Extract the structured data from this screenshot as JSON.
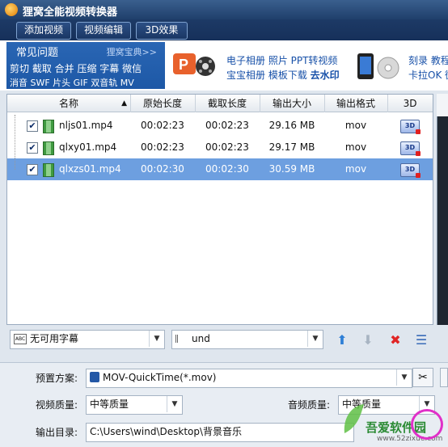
{
  "window": {
    "title": "狸窝全能视频转换器"
  },
  "toolbar": {
    "add_video": "添加视频",
    "edit_video": "视频编辑",
    "effect_3d": "3D效果"
  },
  "faq": {
    "title": "常见问题",
    "more": "狸窝宝典>>",
    "line1": "剪切 截取 合并 压缩 字幕 微信",
    "line2": "消音 SWF 片头 GIF 双音轨 MV"
  },
  "promo": {
    "line1": "电子相册  照片  PPT转视频",
    "line2a": "宝宝相册  模板下载",
    "line2b": "去水印",
    "line3": "刻录  教程",
    "line4": "卡拉OK  微"
  },
  "table": {
    "headers": [
      "名称",
      "原始长度",
      "截取长度",
      "输出大小",
      "输出格式",
      "3D"
    ],
    "rows": [
      {
        "name": "nljs01.mp4",
        "orig": "00:02:23",
        "cut": "00:02:23",
        "size": "29.16 MB",
        "format": "mov"
      },
      {
        "name": "qlxy01.mp4",
        "orig": "00:02:23",
        "cut": "00:02:23",
        "size": "29.17 MB",
        "format": "mov"
      },
      {
        "name": "qlxzs01.mp4",
        "orig": "00:02:30",
        "cut": "00:02:30",
        "size": "30.59 MB",
        "format": "mov"
      }
    ],
    "selected_row": 2
  },
  "subtitle": {
    "value": "无可用字幕",
    "audio": "und"
  },
  "settings": {
    "preset_label": "预置方案:",
    "preset_value": "MOV-QuickTime(*.mov)",
    "video_quality_label": "视频质量:",
    "video_quality": "中等质量",
    "audio_quality_label": "音频质量:",
    "audio_quality": "中等质量",
    "output_label": "输出目录:",
    "output_path": "C:\\Users\\wind\\Desktop\\背景音乐"
  },
  "watermark": {
    "text": "吾爱软件园",
    "url": "www.52zixue.com"
  },
  "colors": {
    "accent": "#1d58a6",
    "selected_row": "#6d9fe0",
    "title_bar": "#1f3f6b"
  }
}
